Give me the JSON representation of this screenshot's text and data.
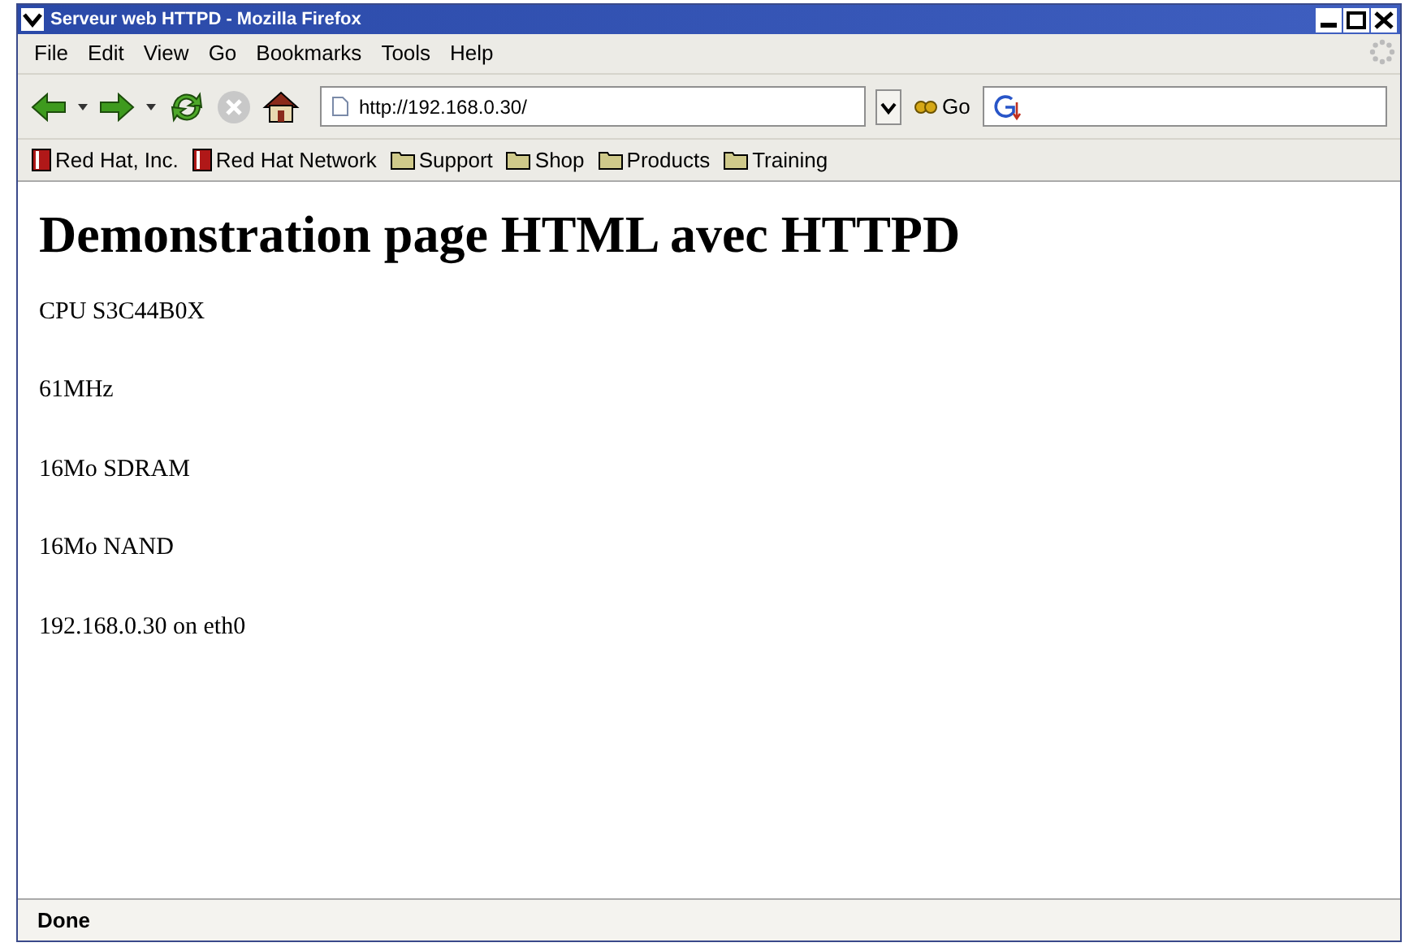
{
  "window": {
    "title": "Serveur web HTTPD - Mozilla Firefox"
  },
  "menu": [
    "File",
    "Edit",
    "View",
    "Go",
    "Bookmarks",
    "Tools",
    "Help"
  ],
  "address": {
    "value": "http://192.168.0.30/"
  },
  "go_label": "Go",
  "bookmarks": [
    {
      "label": "Red Hat, Inc.",
      "kind": "page"
    },
    {
      "label": "Red Hat Network",
      "kind": "page"
    },
    {
      "label": "Support",
      "kind": "folder"
    },
    {
      "label": "Shop",
      "kind": "folder"
    },
    {
      "label": "Products",
      "kind": "folder"
    },
    {
      "label": "Training",
      "kind": "folder"
    }
  ],
  "page": {
    "heading": "Demonstration page HTML avec HTTPD",
    "paragraphs": [
      "CPU S3C44B0X",
      "61MHz",
      "16Mo SDRAM",
      "16Mo NAND",
      "192.168.0.30 on eth0"
    ]
  },
  "status_bar": "Done"
}
